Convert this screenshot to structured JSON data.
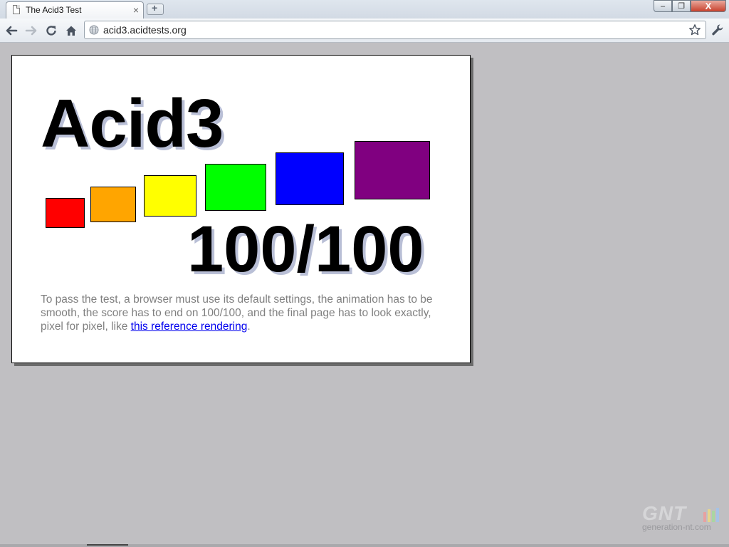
{
  "window": {
    "tab_title": "The Acid3 Test",
    "tab_close": "×",
    "newtab_plus": "+",
    "min_glyph": "–",
    "max_glyph": "❐",
    "close_glyph": "X"
  },
  "toolbar": {
    "url": "acid3.acidtests.org"
  },
  "page": {
    "title": "Acid3",
    "score": "100/100",
    "notice_text": "To pass the test, a browser must use its default settings, the animation has to be smooth, the score has to end on 100/100, and the final page has to look exactly, pixel for pixel, like ",
    "link_text": "this reference rendering",
    "notice_end": "."
  },
  "swatches": [
    {
      "name": "red",
      "color": "#ff0000"
    },
    {
      "name": "orange",
      "color": "#ffa500"
    },
    {
      "name": "yellow",
      "color": "#ffff00"
    },
    {
      "name": "lime",
      "color": "#00ff00"
    },
    {
      "name": "blue",
      "color": "#0000ff"
    },
    {
      "name": "purple",
      "color": "#800080"
    }
  ],
  "watermark": {
    "logo": "GNT",
    "site": "generation-nt.com",
    "bar_colors": [
      "#e7a1a1",
      "#e6d58d",
      "#a9d6a1",
      "#a6c3e6"
    ]
  },
  "colors": {
    "link": "#0000ee",
    "notice_text": "#808080"
  }
}
